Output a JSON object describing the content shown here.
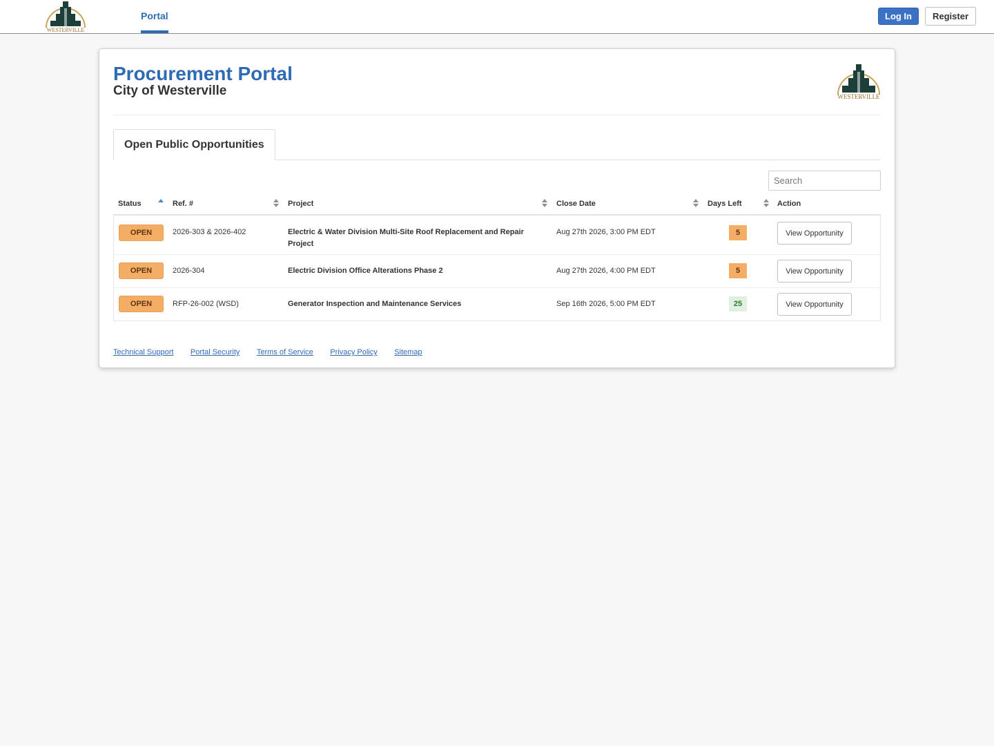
{
  "nav": {
    "tab_label": "Portal",
    "login_label": "Log In",
    "register_label": "Register"
  },
  "brand": {
    "logo_text": "WESTERVILLE",
    "logo_colors": {
      "building": "#1d3f3a",
      "arc": "#c9a35a",
      "text": "#9a6a2a"
    }
  },
  "header": {
    "title": "Procurement Portal",
    "subtitle": "City of Westerville"
  },
  "tabs": [
    {
      "label": "Open Public Opportunities",
      "active": true
    }
  ],
  "search": {
    "placeholder": "Search",
    "value": ""
  },
  "table": {
    "columns": [
      "Status",
      "Ref. #",
      "Project",
      "Close Date",
      "Days Left",
      "Action"
    ],
    "rows": [
      {
        "status": "OPEN",
        "ref": "2026-303 & 2026-402",
        "project": "Electric & Water Division Multi-Site Roof Replacement and Repair Project",
        "close_date": "Aug 27th 2026, 3:00 PM EDT",
        "days_left": "5",
        "action": "View Opportunity"
      },
      {
        "status": "OPEN",
        "ref": "2026-304",
        "project": "Electric Division Office Alterations Phase 2",
        "close_date": "Aug 27th 2026, 4:00 PM EDT",
        "days_left": "5",
        "action": "View Opportunity"
      },
      {
        "status": "OPEN",
        "ref": "RFP-26-002 (WSD)",
        "project": "Generator Inspection and Maintenance Services",
        "close_date": "Sep 16th 2026, 5:00 PM EDT",
        "days_left": "25",
        "action": "View Opportunity"
      }
    ]
  },
  "footer": {
    "links": [
      "Technical Support",
      "Portal Security",
      "Terms of Service",
      "Privacy Policy",
      "Sitemap"
    ]
  },
  "colors": {
    "primary": "#2f6ab5",
    "open_badge": "#f4ad65",
    "days_ok": "#e2f0e2",
    "days_ok_text": "#2a7a2a"
  }
}
